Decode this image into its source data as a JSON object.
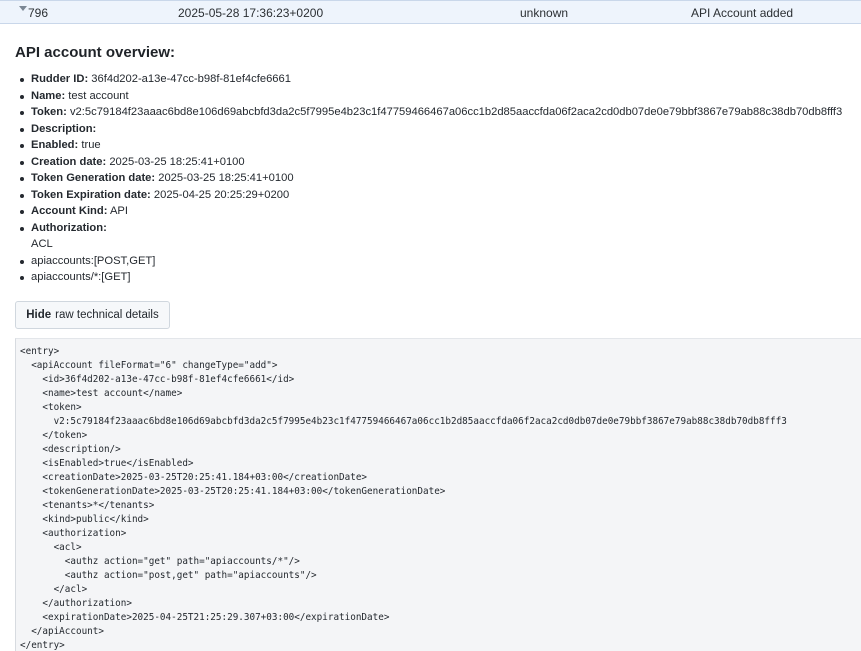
{
  "row": {
    "id": "796",
    "date": "2025-05-28 17:36:23+0200",
    "actor": "unknown",
    "event": "API Account added"
  },
  "details": {
    "title": "API account overview:",
    "fields": [
      {
        "label": "Rudder ID:",
        "value": " 36f4d202-a13e-47cc-b98f-81ef4cfe6661"
      },
      {
        "label": "Name:",
        "value": " test account"
      },
      {
        "label": "Token:",
        "value": " v2:5c79184f23aaac6bd8e106d69abcbfd3da2c5f7995e4b23c1f47759466467a06cc1b2d85aaccfda06f2aca2cd0db07de0e79bbf3867e79ab88c38db70db8fff3"
      },
      {
        "label": "Description:",
        "value": ""
      },
      {
        "label": "Enabled:",
        "value": " true"
      },
      {
        "label": "Creation date:",
        "value": " 2025-03-25 18:25:41+0100"
      },
      {
        "label": "Token Generation date:",
        "value": " 2025-03-25 18:25:41+0100"
      },
      {
        "label": "Token Expiration date:",
        "value": " 2025-04-25 20:25:29+0200"
      },
      {
        "label": "Account Kind:",
        "value": " API"
      },
      {
        "label": "Authorization:",
        "value": ""
      }
    ],
    "acl_label": "ACL",
    "acl_items": [
      "apiaccounts:[POST,GET]",
      "apiaccounts/*:[GET]"
    ]
  },
  "toggle": {
    "bold": "Hide",
    "rest": "raw technical details"
  },
  "raw_xml": "<entry>\n  <apiAccount fileFormat=\"6\" changeType=\"add\">\n    <id>36f4d202-a13e-47cc-b98f-81ef4cfe6661</id>\n    <name>test account</name>\n    <token>\n      v2:5c79184f23aaac6bd8e106d69abcbfd3da2c5f7995e4b23c1f47759466467a06cc1b2d85aaccfda06f2aca2cd0db07de0e79bbf3867e79ab88c38db70db8fff3\n    </token>\n    <description/>\n    <isEnabled>true</isEnabled>\n    <creationDate>2025-03-25T20:25:41.184+03:00</creationDate>\n    <tokenGenerationDate>2025-03-25T20:25:41.184+03:00</tokenGenerationDate>\n    <tenants>*</tenants>\n    <kind>public</kind>\n    <authorization>\n      <acl>\n        <authz action=\"get\" path=\"apiaccounts/*\"/>\n        <authz action=\"post,get\" path=\"apiaccounts\"/>\n      </acl>\n    </authorization>\n    <expirationDate>2025-04-25T21:25:29.307+03:00</expirationDate>\n  </apiAccount>\n</entry>"
}
